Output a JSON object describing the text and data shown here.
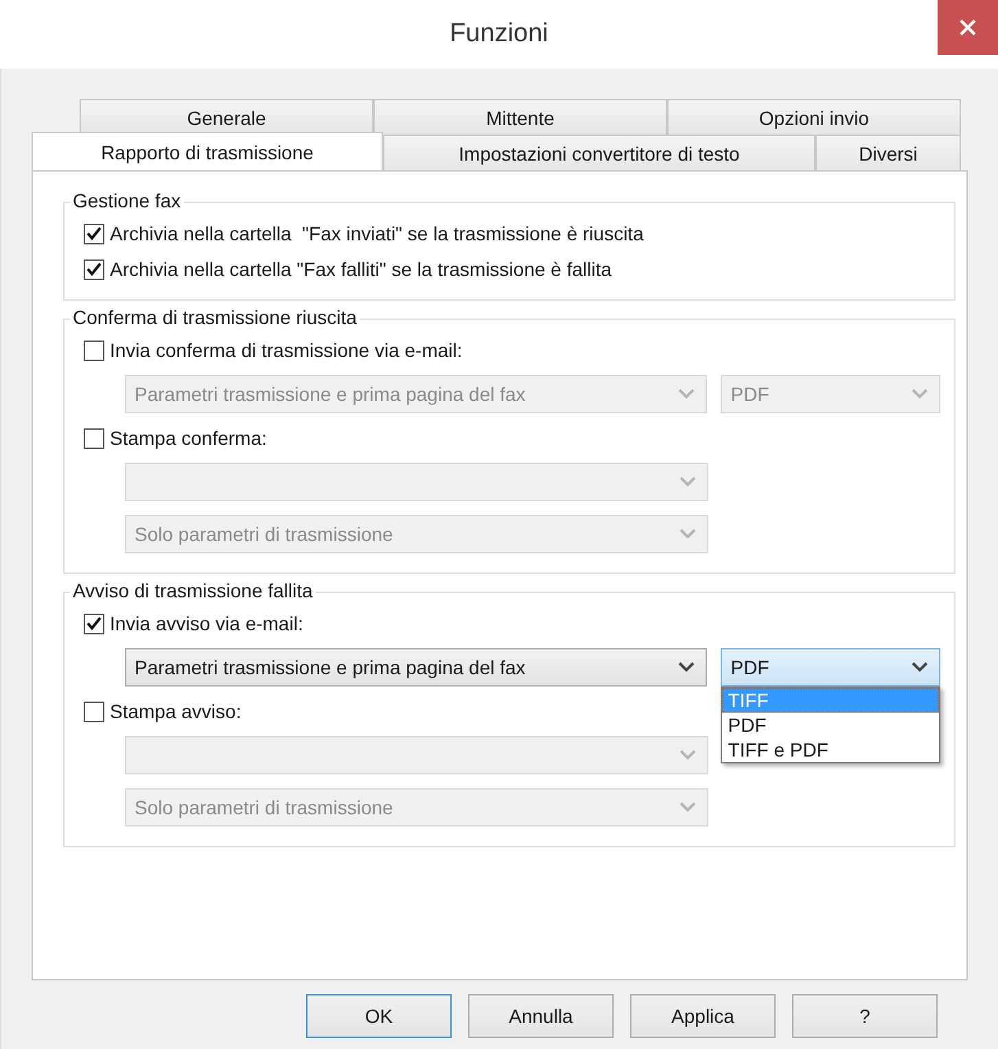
{
  "window": {
    "title": "Funzioni"
  },
  "tab_rows": [
    {
      "tabs": [
        {
          "label": "Generale",
          "selected": false
        },
        {
          "label": "Mittente",
          "selected": false
        },
        {
          "label": "Opzioni invio",
          "selected": false
        }
      ]
    },
    {
      "tabs": [
        {
          "label": "Rapporto di trasmissione",
          "selected": true
        },
        {
          "label": "Impostazioni convertitore di testo",
          "selected": false
        },
        {
          "label": "Diversi",
          "selected": false
        }
      ]
    }
  ],
  "groups": [
    {
      "title": "Gestione fax",
      "rows": [
        {
          "kind": "checkbox",
          "label": "Archivia nella cartella  \"Fax inviati\" se la trasmissione è riuscita",
          "checked": true
        },
        {
          "kind": "checkbox",
          "label": "Archivia nella cartella \"Fax falliti\" se la trasmissione è fallita",
          "checked": true
        }
      ]
    },
    {
      "title": "Conferma di trasmissione riuscita",
      "rows": [
        {
          "kind": "checkbox",
          "label": "Invia conferma di trasmissione via e-mail:",
          "checked": false
        },
        {
          "kind": "dropdowns",
          "dropdowns": [
            {
              "value": "Parametri trasmissione e prima pagina del fax",
              "disabled": true
            },
            {
              "value": "PDF",
              "disabled": true
            }
          ]
        },
        {
          "kind": "checkbox",
          "label": "Stampa conferma:",
          "checked": false
        },
        {
          "kind": "dropdowns",
          "dropdowns": [
            {
              "disabled": true
            }
          ]
        },
        {
          "kind": "dropdowns",
          "dropdowns": [
            {
              "value": "Solo parametri di trasmissione",
              "disabled": true
            }
          ]
        }
      ]
    },
    {
      "title": "Avviso di trasmissione fallita",
      "rows": [
        {
          "kind": "checkbox",
          "label": "Invia avviso via e-mail:",
          "checked": true
        },
        {
          "kind": "dropdowns",
          "dropdowns": [
            {
              "value": "Parametri trasmissione e prima pagina del fax",
              "disabled": false
            },
            {
              "value": "PDF",
              "disabled": false,
              "expanded": true,
              "options": [
                {
                  "label": "TIFF",
                  "highlighted": true
                },
                {
                  "label": "PDF",
                  "highlighted": false
                },
                {
                  "label": "TIFF e PDF",
                  "highlighted": false
                }
              ]
            }
          ]
        },
        {
          "kind": "checkbox",
          "label": "Stampa avviso:",
          "checked": false
        },
        {
          "kind": "dropdowns",
          "dropdowns": [
            {
              "disabled": true
            }
          ]
        },
        {
          "kind": "dropdowns",
          "dropdowns": [
            {
              "value": "Solo parametri di trasmissione",
              "disabled": true
            }
          ]
        }
      ]
    }
  ],
  "buttons": [
    {
      "label": "OK",
      "default": true
    },
    {
      "label": "Annulla",
      "default": false
    },
    {
      "label": "Applica",
      "default": false
    },
    {
      "label": "?",
      "default": false
    }
  ]
}
